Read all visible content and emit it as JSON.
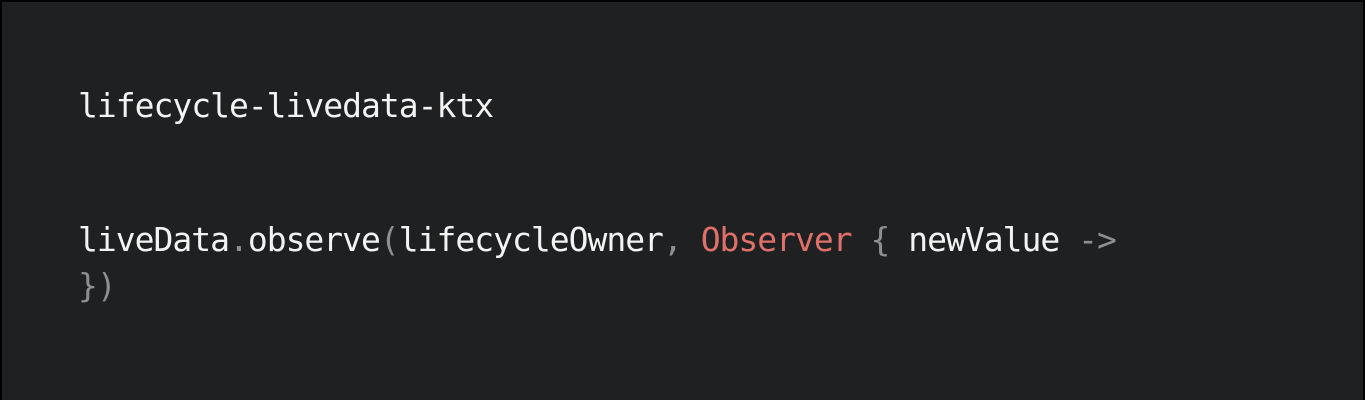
{
  "code": {
    "line1": "lifecycle-livedata-ktx",
    "line2": {
      "receiver": "liveData",
      "dot": ".",
      "method": "observe",
      "open_paren": "(",
      "arg_owner": "lifecycleOwner",
      "comma": ", ",
      "observer_class": "Observer",
      "open_brace": " { ",
      "param": "newValue",
      "arrow": " ->"
    },
    "line3": {
      "close_brace": "}",
      "close_paren": ")"
    }
  },
  "colors": {
    "background": "#1e2021",
    "text": "#f3f3f3",
    "punctuation": "#8f8f8f",
    "class_name": "#e0706a"
  }
}
